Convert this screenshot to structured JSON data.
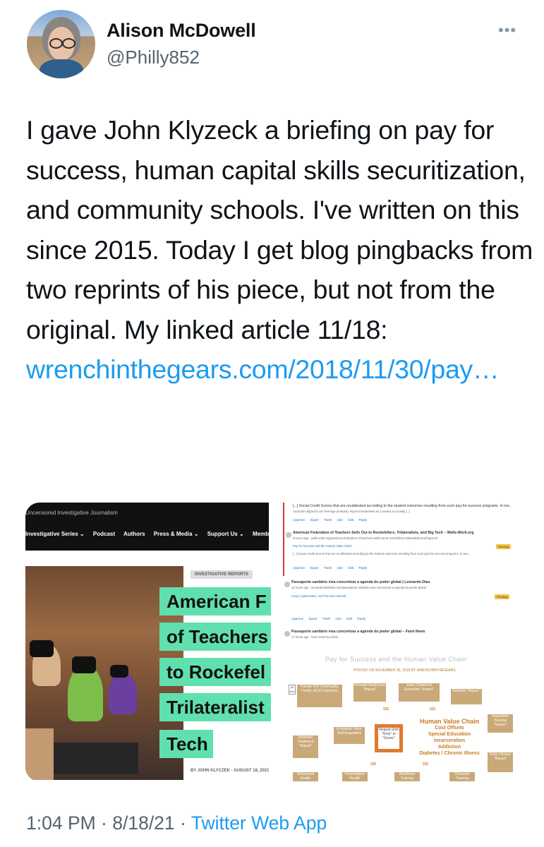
{
  "user": {
    "name": "Alison McDowell",
    "handle": "@Philly852"
  },
  "tweet": {
    "text": "I gave John Klyzeck a briefing on pay for success, human capital skills securitization, and community schools. I've written on this since 2015. Today I get blog pingbacks from two reprints of his piece, but not from the original. My linked article 11/18:",
    "link": "wrenchinthegears.com/2018/11/30/​pay…"
  },
  "media": {
    "site_tagline": "Uncensored Investigative Journalism",
    "nav_items": [
      "Investigative Series ⌄",
      "Podcast",
      "Authors",
      "Press & Media ⌄",
      "Support Us ⌄",
      "Memb"
    ],
    "category": "INVESTIGATIVE REPORTS",
    "headline_lines": [
      "American F",
      "of Teachers",
      "to Rockefel",
      "Trilateralist",
      "Tech"
    ],
    "byline": "BY JOHN KLYCZEK · AUGUST 18, 2021",
    "comments": [
      {
        "title": "[...] Social Credit Scores that are recalibrated according to the student outcomes resulting from such pay-for-success programs. In turn,",
        "line": "corporate oligarchs can leverage predatory impact investments as a means to socially [...]"
      },
      {
        "title": "American Federation of Teachers Sells Out to Rockefellers, Trilateralists, and Big Tech – Walls-Work.org",
        "line": "6 hours ago · walls-work.org/american-federation-of-teachers-sells-out-to-rockefellers-trilateralists-and-big-tech",
        "ref": "Pay for Success and the Human Value Chain",
        "status": "Pending"
      },
      {
        "title": "Passaporte sanitário visa concretizar a agenda do poder global | Leonardo Dias",
        "line": "16 hours ago · leonardodiasbahia.com/passaporte-sanitario-visa-concretizar-a-agenda-do-poder-global",
        "ref": "Covid, Cybernetics, And The New Normal",
        "status": "Pending"
      },
      {
        "title": "Passaporte sanitário visa concretizar a agenda do poder global – Farol News",
        "line": "17 hours ago · farol.news/?p=21011"
      }
    ],
    "actions": [
      "Approve",
      "Spam",
      "Trash",
      "Like",
      "Edit",
      "Reply"
    ],
    "diagram": {
      "title": "Pay for Success and the Human Value Chain",
      "posted": "POSTED ON NOVEMBER 30, 2018 BY WRENCHINTHEGEARS",
      "boxes": [
        "Human ROI Community, Family, ACES Genomic",
        "Prenatal Healthcare \"Impact\"",
        "Early Childhood Education \"Impact\"",
        "Nutrition \"Impact\"",
        "Supportive Housing \"Impact\"",
        "Early Literacy \"Impact\"",
        "Economic Value Skill Acquisition",
        "Repeat Until \"Grey\" or \"Grave\"",
        "Addiction Treatment \"Impact\"",
        "Behavioral Health",
        "Preventative Health",
        "Workforce Training",
        "Character Training"
      ],
      "center_title": "Human Value Chain",
      "center_lines": [
        "Cost Offsets",
        "Special Education",
        "Incarceration",
        "Addiction",
        "Diabetes / Chronic Illness"
      ],
      "date_badge": "30 Nov",
      "money": "$$$"
    }
  },
  "footer": {
    "time": "1:04 PM · 8/18/21 · ",
    "app": "Twitter Web App"
  },
  "colors": {
    "link": "#1d9bf0",
    "headline_bg": "#5fe0ae",
    "muted": "#536471"
  }
}
